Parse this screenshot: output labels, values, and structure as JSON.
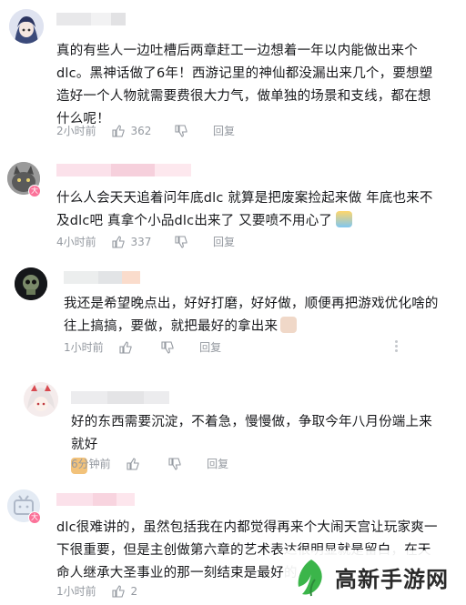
{
  "comments": [
    {
      "text": "真的有些人一边吐槽后两章赶工一边想着一年以内能做出来个dlc。黑神话做了6年！西游记里的神仙都没漏出来几个，要想塑造好一个人物就需要费很大力气，做单独的场景和支线，都在想什么呢！",
      "time": "2小时前",
      "likes": "362",
      "reply": "回复"
    },
    {
      "text": "什么人会天天追着问年底dlc 就算是把废案捡起来做 年底也来不及dlc吧 真拿个小品dlc出来了 又要喷不用心了",
      "time": "4小时前",
      "likes": "337",
      "reply": "回复"
    },
    {
      "text": "我还是希望晚点出，好好打磨，好好做，顺便再把游戏优化啥的往上搞搞，要做，就把最好的拿出来",
      "time": "1小时前",
      "likes": "",
      "reply": "回复"
    },
    {
      "text": "好的东西需要沉淀，不着急，慢慢做，争取今年八月份端上来就好",
      "time": "6分钟前",
      "likes": "",
      "reply": "回复"
    },
    {
      "text": "dlc很难讲的，虽然包括我在内都觉得再来个大闹天宫让玩家爽一下很重要，但是主创做第六章的艺术表达很明显就是留白，在天命人继承大圣事业的那一刻结束是最好的",
      "time": "1小时前",
      "likes": "2",
      "reply": "回复"
    }
  ],
  "watermark": {
    "text": "高新手游网"
  },
  "colors": {
    "text": "#18191c",
    "meta": "#9499a0",
    "badge": "#fb7299",
    "logo_green": "#3bb54a"
  }
}
